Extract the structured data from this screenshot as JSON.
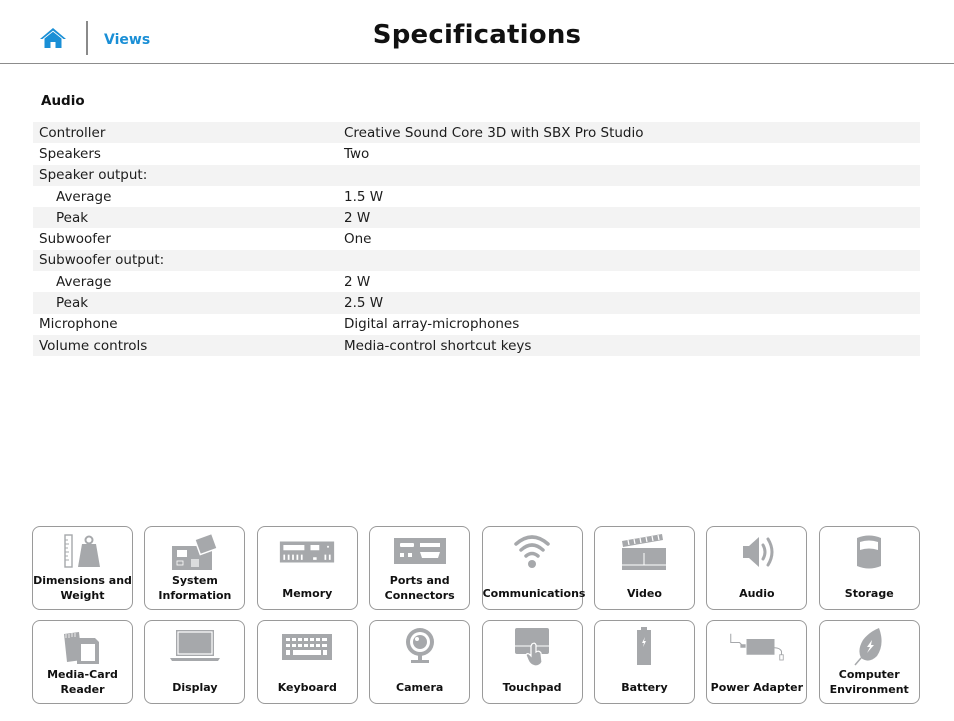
{
  "header": {
    "home_icon": "home-icon",
    "views_link": "Views",
    "title": "Specifications"
  },
  "colors": {
    "accent": "#1a8fd6",
    "icon_gray": "#a6a8ab",
    "row_shade": "#f3f3f3",
    "tile_border": "#9a9a9a"
  },
  "section": {
    "title": "Audio",
    "rows": [
      {
        "label": "Controller",
        "value": "Creative Sound Core 3D with SBX Pro Studio",
        "indent": false
      },
      {
        "label": "Speakers",
        "value": "Two",
        "indent": false
      },
      {
        "label": "Speaker output:",
        "value": "",
        "indent": false
      },
      {
        "label": "Average",
        "value": "1.5 W",
        "indent": true
      },
      {
        "label": "Peak",
        "value": "2 W",
        "indent": true
      },
      {
        "label": "Subwoofer",
        "value": "One",
        "indent": false
      },
      {
        "label": "Subwoofer output:",
        "value": "",
        "indent": false
      },
      {
        "label": "Average",
        "value": "2 W",
        "indent": true
      },
      {
        "label": "Peak",
        "value": "2.5 W",
        "indent": true
      },
      {
        "label": "Microphone",
        "value": "Digital array-microphones",
        "indent": false
      },
      {
        "label": "Volume controls",
        "value": "Media-control shortcut keys",
        "indent": false
      }
    ]
  },
  "tiles": [
    {
      "label": "Dimensions and\nWeight",
      "icon": "dimensions-weight-icon"
    },
    {
      "label": "System\nInformation",
      "icon": "system-board-icon"
    },
    {
      "label": "Memory",
      "icon": "memory-module-icon"
    },
    {
      "label": "Ports and\nConnectors",
      "icon": "ports-icon"
    },
    {
      "label": "Communications",
      "icon": "wifi-icon"
    },
    {
      "label": "Video",
      "icon": "clapperboard-icon"
    },
    {
      "label": "Audio",
      "icon": "speaker-icon"
    },
    {
      "label": "Storage",
      "icon": "storage-drive-icon"
    },
    {
      "label": "Media-Card\nReader",
      "icon": "media-card-icon"
    },
    {
      "label": "Display",
      "icon": "laptop-display-icon"
    },
    {
      "label": "Keyboard",
      "icon": "keyboard-icon"
    },
    {
      "label": "Camera",
      "icon": "webcam-icon"
    },
    {
      "label": "Touchpad",
      "icon": "touchpad-icon"
    },
    {
      "label": "Battery",
      "icon": "battery-icon"
    },
    {
      "label": "Power Adapter",
      "icon": "power-adapter-icon"
    },
    {
      "label": "Computer\nEnvironment",
      "icon": "leaf-icon"
    }
  ]
}
